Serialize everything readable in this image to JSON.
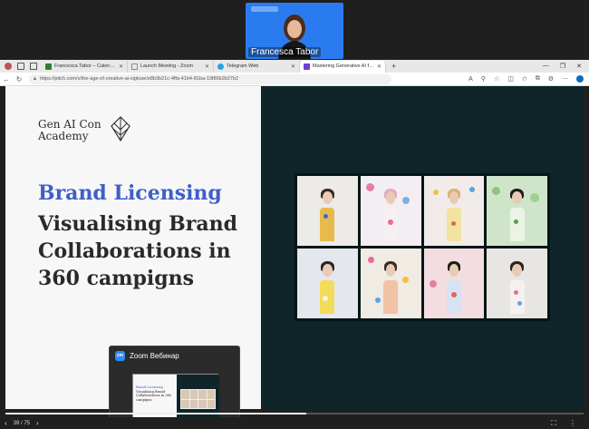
{
  "speaker": {
    "name": "Francesca Tabor"
  },
  "browser": {
    "tabs": [
      {
        "label": "Francesca Tabor – Calendar - Wo",
        "color": "#2e7d32"
      },
      {
        "label": "Launch Meeting - Zoom",
        "color": "#8a8a8a"
      },
      {
        "label": "Telegram Web",
        "color": "#2aa3df"
      },
      {
        "label": "Mastering Generative AI for Bus",
        "color": "#6c3fd1"
      }
    ],
    "url": "https://pitch.com/v/the-age-of-creative-ai-sigtuse/e8b3b21c-4ffa-41b4-81ba-19f86b2b27b2"
  },
  "slide": {
    "academy_line1": "Gen AI Con",
    "academy_line2": "Academy",
    "heading_blue": "Brand Licensing",
    "heading_lines": [
      "Visualising Brand",
      "Collaborations in",
      "360 campigns"
    ]
  },
  "zoom_popup": {
    "title": "Zoom Вебинар",
    "logo": "zm",
    "thumb_blue": "Brand Licensing",
    "thumb_text": "Visualising Brand Collaborations in 360 campigns"
  },
  "controls": {
    "page": "39 / 75"
  }
}
